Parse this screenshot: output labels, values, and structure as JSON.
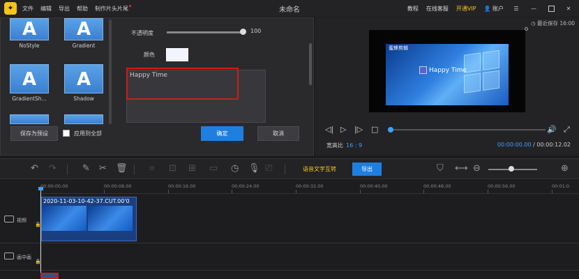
{
  "titlebar": {
    "menu": [
      "文件",
      "编辑",
      "导出",
      "帮助",
      "制作片头片尾"
    ],
    "title": "未命名",
    "right": {
      "tutorial": "教程",
      "support": "在线客服",
      "vip": "开通VIP",
      "account": "账户"
    }
  },
  "styles_panel": {
    "items": [
      "NoStyle",
      "Gradient",
      "GradientSh...",
      "Shadow"
    ],
    "thumb_letter": "A"
  },
  "text_props": {
    "opacity_label": "不透明度",
    "opacity_value": "100",
    "color_label": "颜色",
    "text_value": "Happy Time"
  },
  "panel_buttons": {
    "save_preset": "保存为预设",
    "apply_all": "应用到全部",
    "ok": "确定",
    "cancel": "取消"
  },
  "preview": {
    "autosave": "最近保存 16:00",
    "watermark": "蜜蜂剪辑",
    "caption": "Happy Time",
    "aspect_label": "宽高比",
    "aspect_value": "16 : 9",
    "current_time": "00:00:00.00",
    "total_time": "/ 00:00:12.02"
  },
  "toolbar": {
    "tts_label": "语音文字互转",
    "export_label": "导出"
  },
  "timeline": {
    "ticks": [
      "00:00:00.00",
      "00:00:08.00",
      "00:00:16.00",
      "00:00:24.00",
      "00:00:32.00",
      "00:00:40.00",
      "00:00:48.00",
      "00:00:56.00",
      "00:01:0"
    ],
    "tracks": [
      "视频",
      "画中画"
    ],
    "clip_name": "2020-11-03-10-42-37.CUT.00'0"
  },
  "colors": {
    "accent_blue": "#1f7fe0",
    "vip_yellow": "#f5c518",
    "highlight_red": "#d01a1a"
  }
}
